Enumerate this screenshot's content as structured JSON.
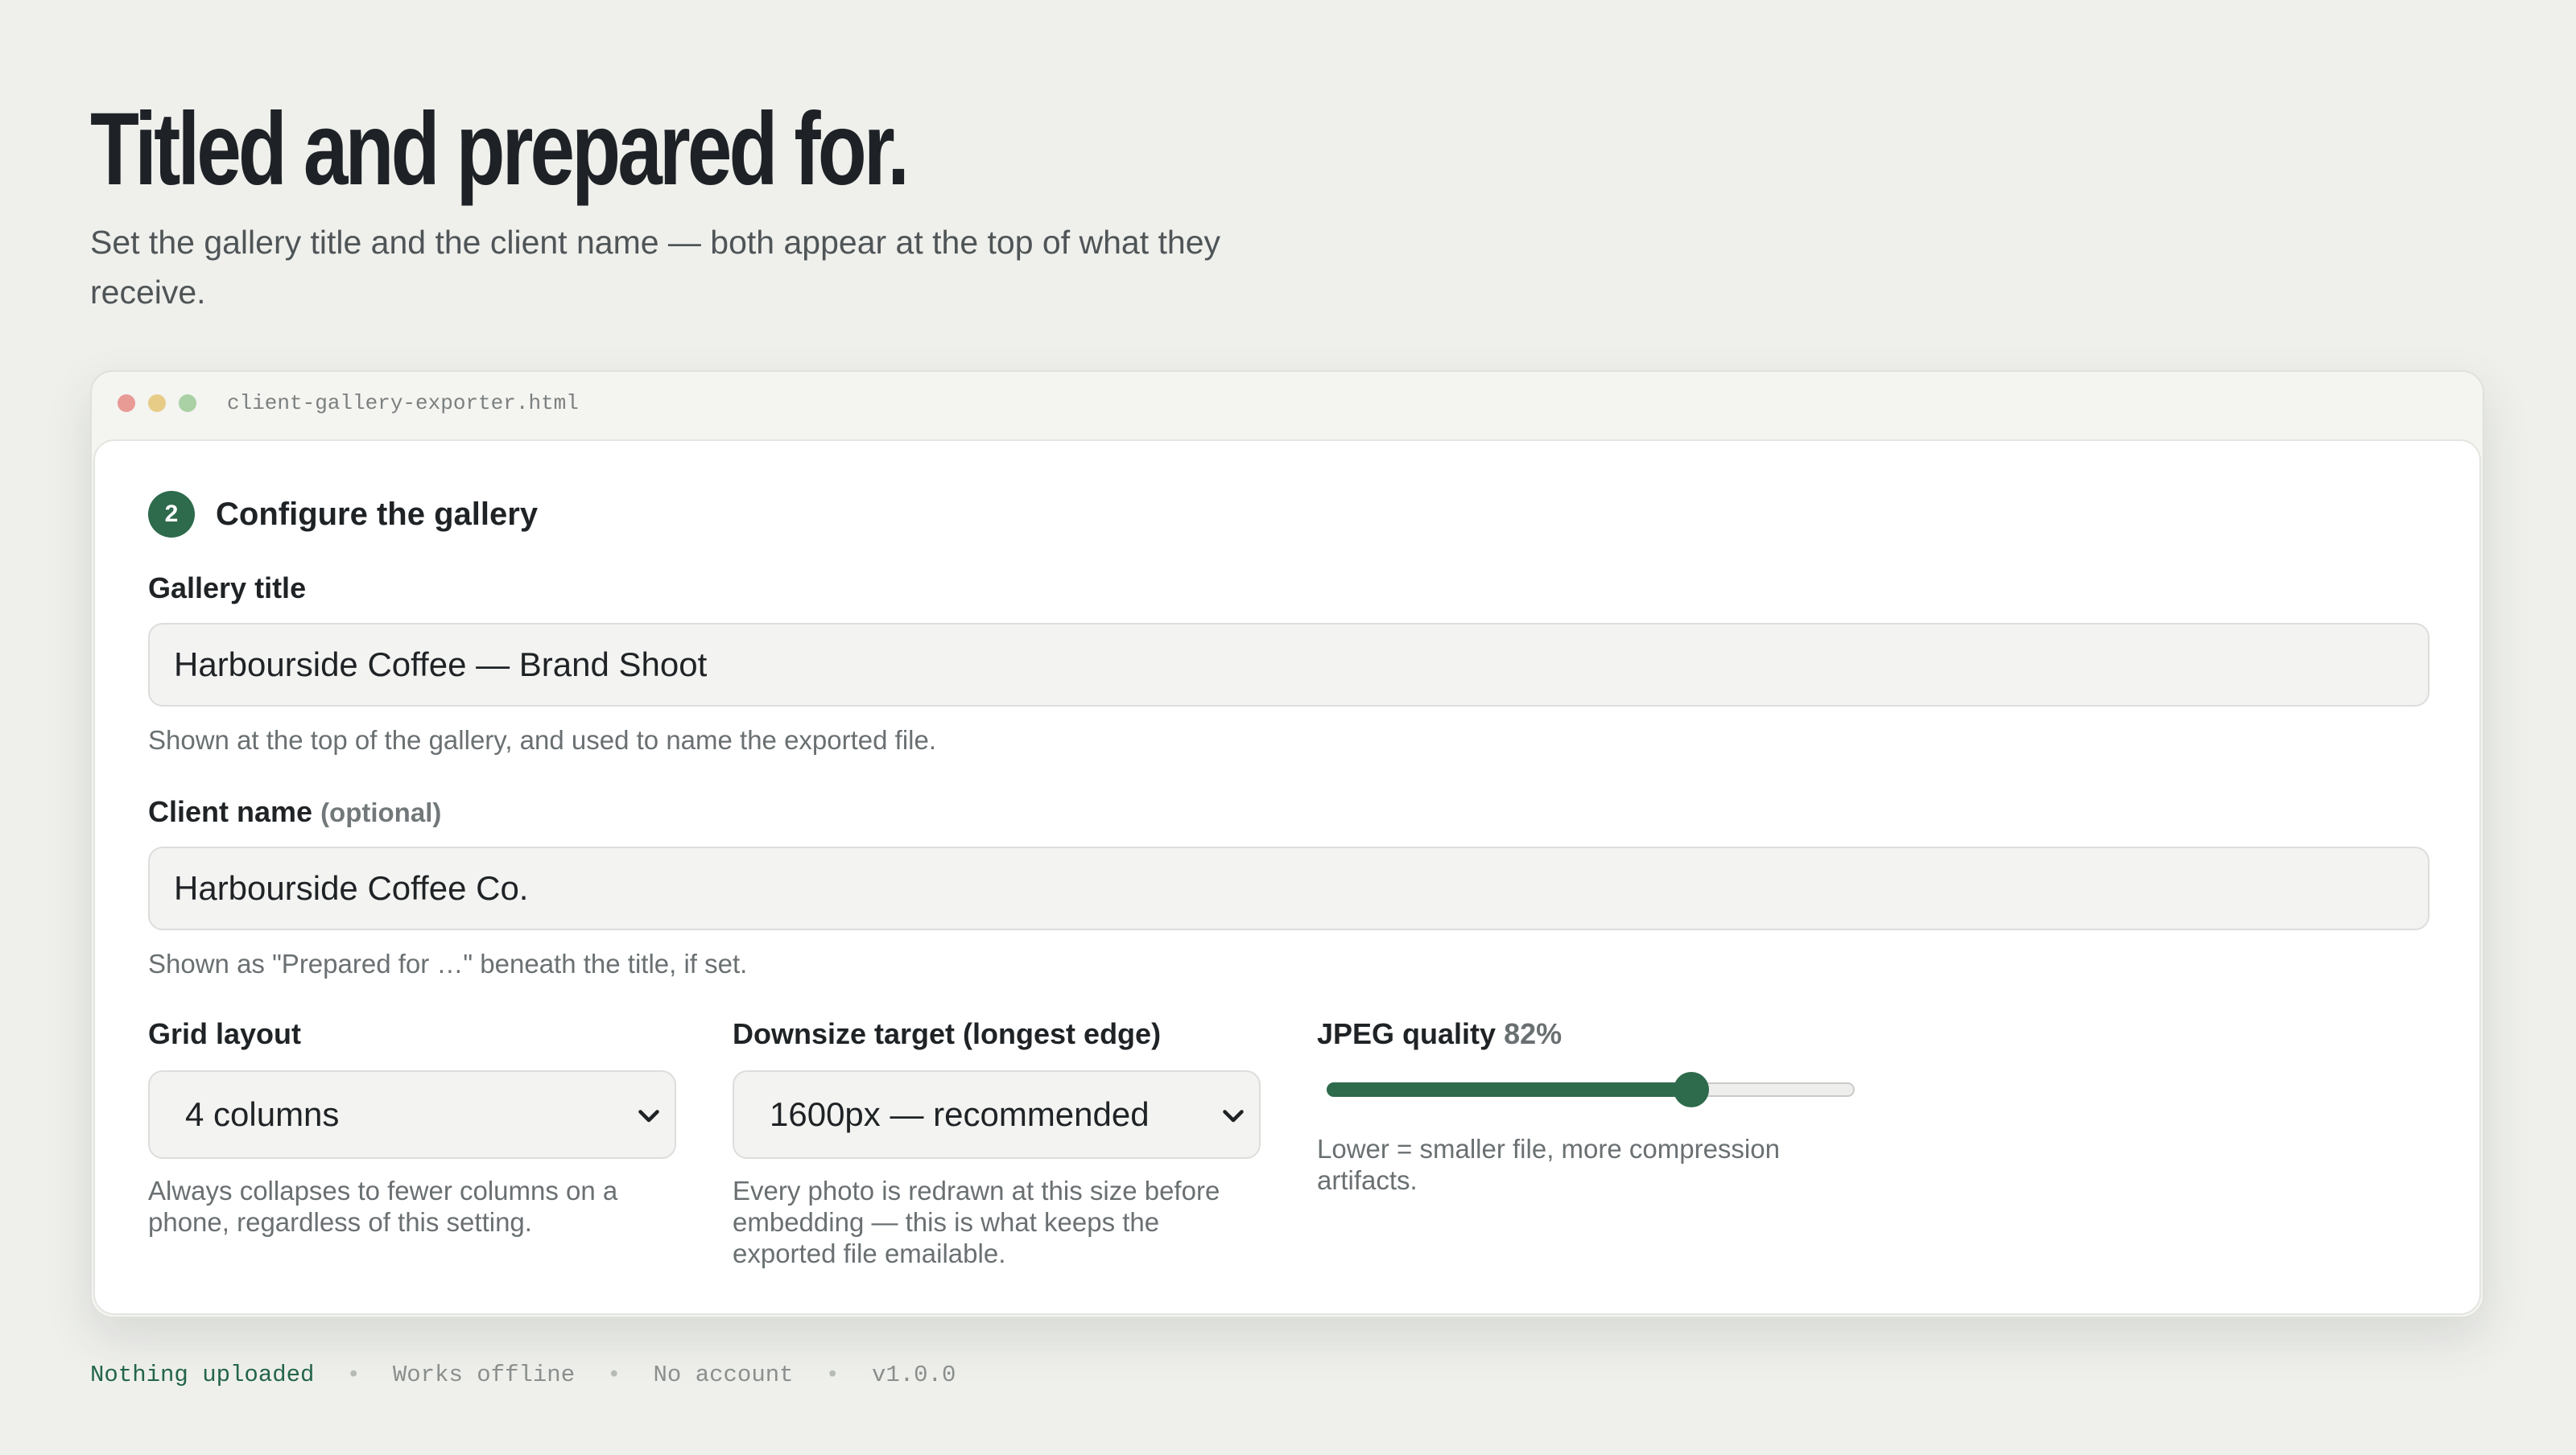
{
  "hero": {
    "title": "Titled and prepared for.",
    "subtitle": "Set the gallery title and the client name — both appear at the top of what they receive."
  },
  "window": {
    "filename": "client-gallery-exporter.html"
  },
  "step": {
    "number": "2",
    "title": "Configure the gallery"
  },
  "gallery_title": {
    "label": "Gallery title",
    "value": "Harbourside Coffee — Brand Shoot",
    "hint": "Shown at the top of the gallery, and used to name the exported file."
  },
  "client_name": {
    "label": "Client name",
    "optional": "(optional)",
    "value": "Harbourside Coffee Co.",
    "hint": "Shown as \"Prepared for …\" beneath the title, if set."
  },
  "grid_layout": {
    "label": "Grid layout",
    "selected": "4 columns",
    "hint": "Always collapses to fewer columns on a phone, regardless of this setting."
  },
  "downsize": {
    "label": "Downsize target (longest edge)",
    "selected": "1600px — recommended",
    "hint": "Every photo is redrawn at this size before embedding — this is what keeps the exported file emailable."
  },
  "jpeg_quality": {
    "label": "JPEG quality",
    "value_text": "82%",
    "level": 0.69,
    "hint": "Lower = smaller file, more compression artifacts."
  },
  "footer": {
    "items": [
      "Nothing uploaded",
      "Works offline",
      "No account",
      "v1.0.0"
    ],
    "separator": "•"
  },
  "colors": {
    "accent": "#2e6a4c",
    "background": "#eff0ec"
  }
}
